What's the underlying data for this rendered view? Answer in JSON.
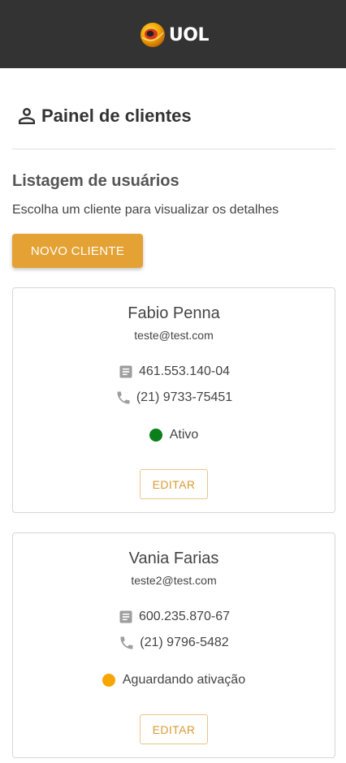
{
  "header": {
    "logo_text": "UOL",
    "logo_icon": "uol-logo-icon",
    "background_color": "#333333"
  },
  "page": {
    "title": "Painel de clientes",
    "title_icon": "person-icon",
    "subtitle": "Listagem de usuários",
    "hint": "Escolha um cliente para visualizar os detalhes",
    "new_client_label": "NOVO CLIENTE",
    "accent_color": "#e5a234"
  },
  "clients": [
    {
      "name": "Fabio Penna",
      "email": "teste@test.com",
      "document": "461.553.140-04",
      "document_icon": "document-icon",
      "phone": "(21) 9733-75451",
      "phone_icon": "phone-icon",
      "status": "Ativo",
      "status_color": "#0a7f1a",
      "edit_label": "EDITAR"
    },
    {
      "name": "Vania Farias",
      "email": "teste2@test.com",
      "document": "600.235.870-67",
      "document_icon": "document-icon",
      "phone": "(21) 9796-5482",
      "phone_icon": "phone-icon",
      "status": "Aguardando ativação",
      "status_color": "#f7a600",
      "edit_label": "EDITAR"
    }
  ]
}
